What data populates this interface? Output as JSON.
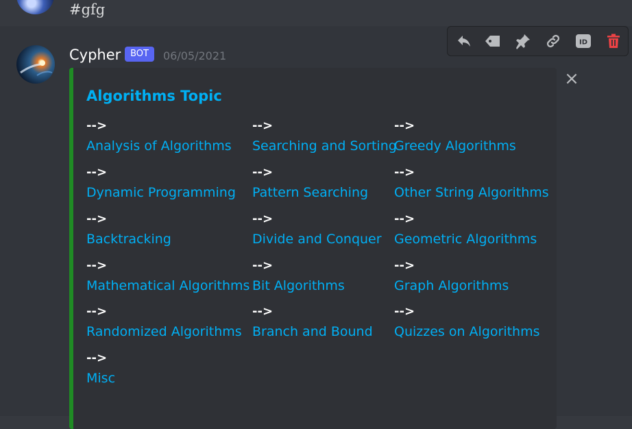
{
  "previous_message": {
    "text": "#gfg"
  },
  "message": {
    "username": "Cypher",
    "badge": "BOT",
    "timestamp": "06/05/2021"
  },
  "toolbar": {
    "icons": [
      "reply-icon",
      "tag-icon",
      "pin-icon",
      "link-icon",
      "id-icon",
      "delete-icon"
    ],
    "id_label": "ID",
    "delete_color": "#ed4245"
  },
  "embed": {
    "accent_color": "#1f8b24",
    "title": "Algorithms Topic",
    "close_glyph": "×",
    "fields": [
      {
        "name": "-->",
        "value": "Analysis of Algorithms"
      },
      {
        "name": "-->",
        "value": "Searching and Sorting"
      },
      {
        "name": "-->",
        "value": "Greedy Algorithms"
      },
      {
        "name": "-->",
        "value": "Dynamic Programming"
      },
      {
        "name": "-->",
        "value": "Pattern Searching"
      },
      {
        "name": "-->",
        "value": "Other String Algorithms"
      },
      {
        "name": "-->",
        "value": "Backtracking"
      },
      {
        "name": "-->",
        "value": "Divide and Conquer"
      },
      {
        "name": "-->",
        "value": "Geometric Algorithms"
      },
      {
        "name": "-->",
        "value": "Mathematical Algorithms"
      },
      {
        "name": "-->",
        "value": "Bit Algorithms"
      },
      {
        "name": "-->",
        "value": "Graph Algorithms"
      },
      {
        "name": "-->",
        "value": "Randomized Algorithms"
      },
      {
        "name": "-->",
        "value": "Branch and Bound"
      },
      {
        "name": "-->",
        "value": "Quizzes on Algorithms"
      },
      {
        "name": "-->",
        "value": "Misc"
      }
    ]
  }
}
